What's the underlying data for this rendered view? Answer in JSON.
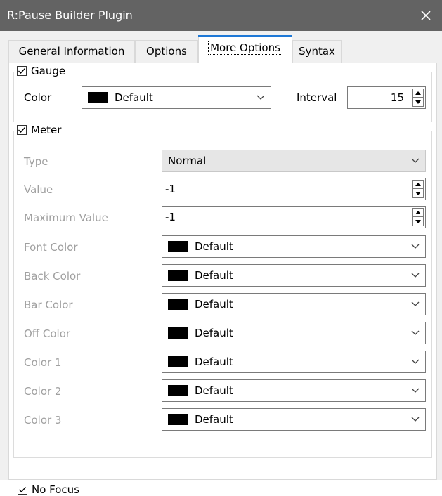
{
  "window": {
    "title": "R:Pause Builder Plugin"
  },
  "tabs": [
    {
      "label": "General Information"
    },
    {
      "label": "Options"
    },
    {
      "label": "More Options"
    },
    {
      "label": "Syntax"
    }
  ],
  "gauge": {
    "label": "Gauge",
    "checked": true,
    "color_label": "Color",
    "color_value": "Default",
    "interval_label": "Interval",
    "interval_value": "15"
  },
  "meter": {
    "label": "Meter",
    "checked": true,
    "rows": {
      "type": {
        "label": "Type",
        "value": "Normal"
      },
      "value": {
        "label": "Value",
        "value": "-1"
      },
      "max": {
        "label": "Maximum Value",
        "value": "-1"
      },
      "font_color": {
        "label": "Font Color",
        "value": "Default"
      },
      "back_color": {
        "label": "Back Color",
        "value": "Default"
      },
      "bar_color": {
        "label": "Bar Color",
        "value": "Default"
      },
      "off_color": {
        "label": "Off Color",
        "value": "Default"
      },
      "color1": {
        "label": "Color 1",
        "value": "Default"
      },
      "color2": {
        "label": "Color 2",
        "value": "Default"
      },
      "color3": {
        "label": "Color 3",
        "value": "Default"
      }
    }
  },
  "no_focus": {
    "label": "No Focus",
    "checked": true
  },
  "colors": {
    "titlebar": "#636363",
    "tab_accent": "#1e78d6",
    "disabled_text": "#a0a0a0",
    "swatch": "#000000"
  }
}
